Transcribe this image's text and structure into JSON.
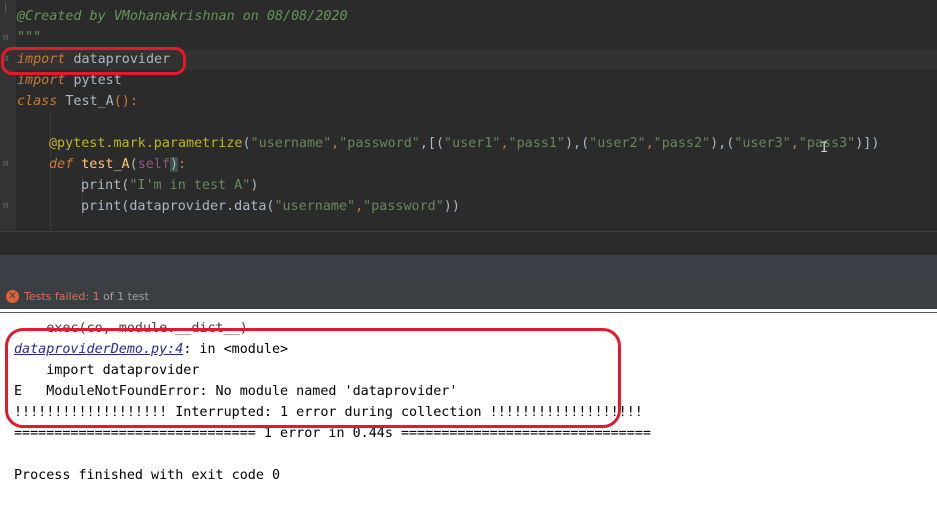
{
  "editor": {
    "comment_line": "@Created by VMohanakrishnan on 08/08/2020",
    "docstring_end": "\"\"\"",
    "line_import1_kw": "import",
    "line_import1_mod": "dataprovider",
    "line_import2_kw": "import",
    "line_import2_mod": "pytest",
    "class_kw": "class",
    "class_name": "Test_A",
    "class_tail": "():",
    "decorator": "@pytest.mark.parametrize",
    "param_open": "(",
    "param_s1": "\"username\"",
    "param_comma1": ",",
    "param_s2": "\"password\"",
    "param_list_open": ",[(",
    "param_s3": "\"user1\"",
    "param_comma2": ",",
    "param_s4": "\"pass1\"",
    "param_mid1": "),(",
    "param_s5": "\"user2\"",
    "param_comma3": ",",
    "param_s6": "\"pass2\"",
    "param_mid2": "),(",
    "param_s7": "\"user3\"",
    "param_comma4": ",",
    "param_s8": "\"pass3\"",
    "param_close": ")])",
    "def_kw": "def",
    "def_name": "test_A",
    "def_open": "(",
    "def_self": "self",
    "def_close_paren": ")",
    "def_colon": ":",
    "print1_fn": "print(",
    "print1_str": "\"I'm in test A\"",
    "print1_close": ")",
    "print2_fn": "print(dataprovider.data(",
    "print2_s1": "\"username\"",
    "print2_comma": ",",
    "print2_s2": "\"password\"",
    "print2_close": "))"
  },
  "status": {
    "label": "Tests failed: 1",
    "tail": " of 1 test",
    "icon": "error-icon"
  },
  "console": {
    "cut_line": "    exec(co, module.__dict__)",
    "file_link": "dataproviderDemo.py:4",
    "file_tail": ": in <module>",
    "import_line": "    import dataprovider",
    "error_line": "E   ModuleNotFoundError: No module named 'dataprovider'",
    "interrupted_line": "!!!!!!!!!!!!!!!!!!! Interrupted: 1 error during collection !!!!!!!!!!!!!!!!!!!",
    "summary_line": "============================== 1 error in 0.44s ===============================",
    "exit_line": "Process finished with exit code 0"
  },
  "colors": {
    "annotation": "#e21a2a",
    "editor_bg": "#2b2b2b",
    "console_bg": "#ffffff"
  }
}
